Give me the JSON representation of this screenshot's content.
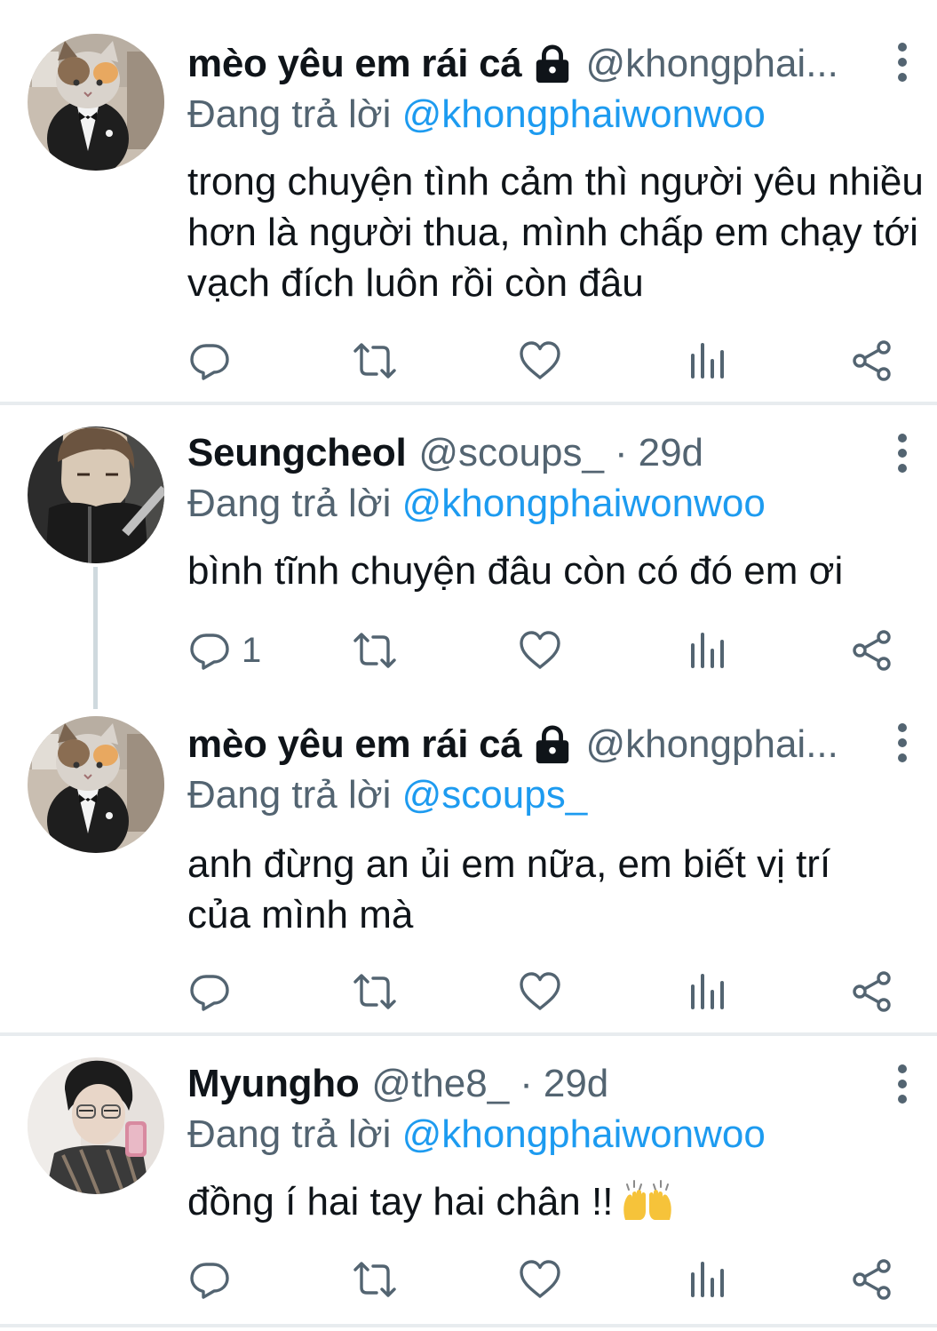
{
  "reply_prefix": "Đang trả lời",
  "tweets": [
    {
      "name": "mèo yêu em rái cá",
      "locked": true,
      "handle": "@khongphai...",
      "time": "",
      "reply_to": "@khongphaiwonwoo",
      "text": "trong chuyện tình cảm thì người yêu nhiều hơn là người thua, mình chấp em chạy tới vạch đích luôn rồi còn đâu",
      "reply_count": ""
    },
    {
      "name": "Seungcheol",
      "locked": false,
      "handle": "@scoups_",
      "separator": "·",
      "time": "29d",
      "reply_to": "@khongphaiwonwoo",
      "text": "bình tĩnh chuyện đâu còn có đó em ơi",
      "reply_count": "1"
    },
    {
      "name": "mèo yêu em rái cá",
      "locked": true,
      "handle": "@khongphai...",
      "time": "",
      "reply_to": "@scoups_",
      "text": "anh đừng an ủi em nữa, em biết vị trí của mình mà",
      "reply_count": ""
    },
    {
      "name": "Myungho",
      "locked": false,
      "handle": "@the8_",
      "separator": "·",
      "time": "29d",
      "reply_to": "@khongphaiwonwoo",
      "text": "đồng í hai tay hai chân !!",
      "emoji": "raising-hands",
      "reply_count": ""
    }
  ],
  "icons": {
    "reply": "reply-icon",
    "retweet": "retweet-icon",
    "like": "heart-icon",
    "views": "views-icon",
    "share": "share-icon",
    "more": "more-vertical-icon",
    "lock": "lock-icon"
  },
  "colors": {
    "text": "#0f1419",
    "muted": "#536471",
    "accent": "#1d9bf0",
    "divider": "#e8ecef"
  }
}
